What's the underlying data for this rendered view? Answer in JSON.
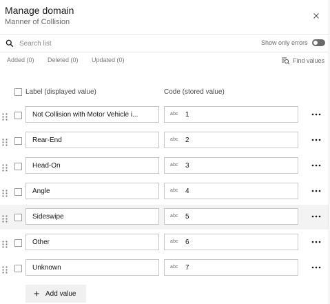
{
  "header": {
    "title": "Manage domain",
    "subtitle": "Manner of Collision"
  },
  "search": {
    "placeholder": "Search list",
    "value": ""
  },
  "errors_toggle": {
    "label": "Show only errors",
    "on": false
  },
  "filters": {
    "added": "Added (0)",
    "deleted": "Deleted (0)",
    "updated": "Updated (0)",
    "find_values": "Find values"
  },
  "columns": {
    "label": "Label (displayed value)",
    "code": "Code (stored value)"
  },
  "type_badge": "abc",
  "rows": [
    {
      "label": "Not Collision with Motor Vehicle i...",
      "code": "1"
    },
    {
      "label": "Rear-End",
      "code": "2"
    },
    {
      "label": "Head-On",
      "code": "3"
    },
    {
      "label": "Angle",
      "code": "4"
    },
    {
      "label": "Sideswipe",
      "code": "5"
    },
    {
      "label": "Other",
      "code": "6"
    },
    {
      "label": "Unknown",
      "code": "7"
    }
  ],
  "add_value_label": "Add value",
  "icons": {
    "close": "close-icon",
    "search": "search-icon",
    "find": "find-values-icon",
    "drag": "drag-handle-icon",
    "more": "more-options-icon",
    "add": "plus-icon"
  },
  "colors": {
    "text": "#151515",
    "muted": "#6a6a6a",
    "border": "#c6c6c6",
    "row_hover": "#f3f3f3",
    "toggle_off": "#6a6a6a"
  }
}
